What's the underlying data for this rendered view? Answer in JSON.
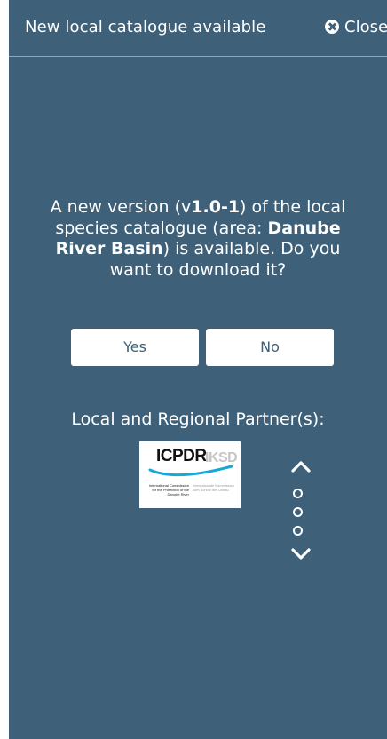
{
  "header": {
    "title": "New local catalogue available",
    "close_label": "Close",
    "close_icon": "close-circle-icon"
  },
  "message": {
    "part1": "A new version (v",
    "version": "1.0-1",
    "part2": ") of the local species catalogue (area: ",
    "area": "Danube River Basin",
    "part3": ") is available. Do you want to download it?"
  },
  "buttons": {
    "yes": "Yes",
    "no": "No"
  },
  "partners": {
    "label": "Local and Regional Partner(s):",
    "logo": {
      "name": "ICPDR",
      "name_secondary": "IKSD",
      "subtitle_left": "International Commission for the Protection of the Danube River",
      "subtitle_right": "Internationale Kommission zum Schutz der Donau"
    },
    "carousel": {
      "up_icon": "chevron-up-icon",
      "down_icon": "chevron-down-icon",
      "dots": 3
    }
  },
  "colors": {
    "background": "#3e6078",
    "text": "#ffffff",
    "button_text": "#3e6078",
    "button_background": "#ffffff",
    "logo_accent": "#18a8d8"
  }
}
